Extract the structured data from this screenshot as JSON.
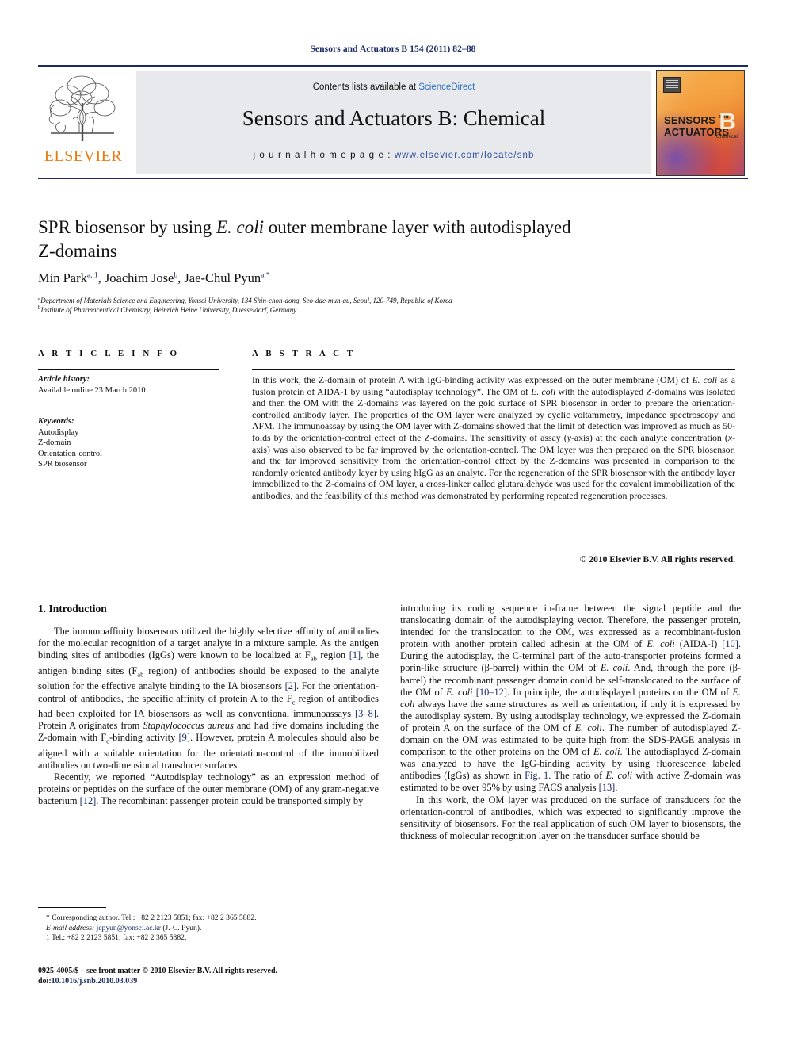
{
  "running_head": "Sensors and Actuators B 154 (2011) 82–88",
  "masthead": {
    "contents_prefix": "Contents lists available at ",
    "sciencedirect": "ScienceDirect",
    "journal_title": "Sensors and Actuators B: Chemical",
    "homepage_label": "j o u r n a l   h o m e p a g e :",
    "homepage_url": "www.elsevier.com/locate/snb",
    "publisher_wordmark": "ELSEVIER",
    "publisher_color": "#e87b10",
    "link_color": "#2c6fbb",
    "cover": {
      "line1": "SENSORS",
      "line1_small": "and",
      "line2": "ACTUATORS",
      "volume_letter": "B",
      "subtitle": "Chemical"
    }
  },
  "article": {
    "title_line1_a": "SPR biosensor by using ",
    "title_line1_italic": "E. coli",
    "title_line1_b": " outer membrane layer with autodisplayed",
    "title_line2": "Z-domains",
    "authors": [
      {
        "name": "Min Park",
        "sup": "a, 1"
      },
      {
        "name": "Joachim Jose",
        "sup": "b"
      },
      {
        "name": "Jae-Chul Pyun",
        "sup": "a,*"
      }
    ],
    "affiliations": [
      {
        "marker": "a",
        "text": "Department of Materials Science and Engineering, Yonsei University, 134 Shin-chon-dong, Seo-dae-mun-gu, Seoul, 120-749, Republic of Korea"
      },
      {
        "marker": "b",
        "text": "Institute of Pharmaceutical Chemistry, Heinrich Heine University, Duesseldorf, Germany"
      }
    ]
  },
  "info": {
    "heading": "A R T I C L E    I N F O",
    "history_label": "Article history:",
    "history_value": "Available online 23 March 2010",
    "keywords_label": "Keywords:",
    "keywords": [
      "Autodisplay",
      "Z-domain",
      "Orientation-control",
      "SPR biosensor"
    ]
  },
  "abstract": {
    "heading": "A B S T R A C T",
    "text_parts": [
      {
        "t": "In this work, the Z-domain of protein A with IgG-binding activity was expressed on the outer membrane (OM) of "
      },
      {
        "t": "E. coli",
        "i": true
      },
      {
        "t": " as a fusion protein of AIDA-1 by using “autodisplay technology”. The OM of "
      },
      {
        "t": "E. coli",
        "i": true
      },
      {
        "t": " with the autodisplayed Z-domains was isolated and then the OM with the Z-domains was layered on the gold surface of SPR biosensor in order to prepare the orientation-controlled antibody layer. The properties of the OM layer were analyzed by cyclic voltammetry, impedance spectroscopy and AFM. The immunoassay by using the OM layer with Z-domains showed that the limit of detection was improved as much as 50-folds by the orientation-control effect of the Z-domains. The sensitivity of assay ("
      },
      {
        "t": "y",
        "i": true
      },
      {
        "t": "-axis) at the each analyte concentration ("
      },
      {
        "t": "x",
        "i": true
      },
      {
        "t": "-axis) was also observed to be far improved by the orientation-control. The OM layer was then prepared on the SPR biosensor, and the far improved sensitivity from the orientation-control effect by the Z-domains was presented in comparison to the randomly oriented antibody layer by using hIgG as an analyte. For the regeneration of the SPR biosensor with the antibody layer immobilized to the Z-domains of OM layer, a cross-linker called glutaraldehyde was used for the covalent immobilization of the antibodies, and the feasibility of this method was demonstrated by performing repeated regeneration processes."
      }
    ],
    "copyright": "© 2010 Elsevier B.V. All rights reserved."
  },
  "body": {
    "section_number_title": "1.  Introduction",
    "left_paragraphs": [
      [
        {
          "t": "The immunoaffinity biosensors utilized the highly selective affinity of antibodies for the molecular recognition of a target analyte in a mixture sample. As the antigen binding sites of antibodies (IgGs) were known to be localized at F"
        },
        {
          "t": "ab",
          "sub": true
        },
        {
          "t": " region "
        },
        {
          "t": "[1]",
          "ref": true
        },
        {
          "t": ", the antigen binding sites (F"
        },
        {
          "t": "ab",
          "sub": true
        },
        {
          "t": " region) of antibodies should be exposed to the analyte solution for the effective analyte binding to the IA biosensors "
        },
        {
          "t": "[2]",
          "ref": true
        },
        {
          "t": ". For the orientation-control of antibodies, the specific affinity of protein A to the F"
        },
        {
          "t": "c",
          "sub": true
        },
        {
          "t": " region of antibodies had been exploited for IA biosensors as well as conventional immunoassays "
        },
        {
          "t": "[3–8]",
          "ref": true
        },
        {
          "t": ". Protein A originates from "
        },
        {
          "t": "Staphylococcus aureus",
          "i": true
        },
        {
          "t": " and had five domains including the Z-domain with F"
        },
        {
          "t": "c",
          "sub": true
        },
        {
          "t": "-binding activity "
        },
        {
          "t": "[9]",
          "ref": true
        },
        {
          "t": ". However, protein A molecules should also be aligned with a suitable orientation for the orientation-control of the immobilized antibodies on two-dimensional transducer surfaces."
        }
      ],
      [
        {
          "t": "Recently, we reported “Autodisplay technology” as an expression method of proteins or peptides on the surface of the outer membrane (OM) of any gram-negative bacterium "
        },
        {
          "t": "[12]",
          "ref": true
        },
        {
          "t": ". The recombinant passenger protein could be transported simply by"
        }
      ]
    ],
    "right_paragraphs": [
      [
        {
          "t": "introducing its coding sequence in-frame between the signal peptide and the translocating domain of the autodisplaying vector. Therefore, the passenger protein, intended for the translocation to the OM, was expressed as a recombinant-fusion protein with another protein called adhesin at the OM of "
        },
        {
          "t": "E. coli",
          "i": true
        },
        {
          "t": " (AIDA-I) "
        },
        {
          "t": "[10]",
          "ref": true
        },
        {
          "t": ". During the autodisplay, the C-terminal part of the auto-transporter proteins formed a porin-like structure (β-barrel) within the OM of "
        },
        {
          "t": "E. coli",
          "i": true
        },
        {
          "t": ". And, through the pore (β-barrel) the recombinant passenger domain could be self-translocated to the surface of the OM of "
        },
        {
          "t": "E. coli",
          "i": true
        },
        {
          "t": " "
        },
        {
          "t": "[10–12]",
          "ref": true
        },
        {
          "t": ". In principle, the autodisplayed proteins on the OM of "
        },
        {
          "t": "E. coli",
          "i": true
        },
        {
          "t": " always have the same structures as well as orientation, if only it is expressed by the autodisplay system. By using autodisplay technology, we expressed the Z-domain of protein A on the surface of the OM of "
        },
        {
          "t": "E. coli",
          "i": true
        },
        {
          "t": ". The number of autodisplayed Z-domain on the OM was estimated to be quite high from the SDS-PAGE analysis in comparison to the other proteins on the OM of "
        },
        {
          "t": "E. coli",
          "i": true
        },
        {
          "t": ". The autodisplayed Z-domain was analyzed to have the IgG-binding activity by using fluorescence labeled antibodies (IgGs) as shown in "
        },
        {
          "t": "Fig. 1",
          "ref": true
        },
        {
          "t": ". The ratio of "
        },
        {
          "t": "E. coli",
          "i": true
        },
        {
          "t": " with active Z-domain was estimated to be over 95% by using FACS analysis "
        },
        {
          "t": "[13]",
          "ref": true
        },
        {
          "t": "."
        }
      ],
      [
        {
          "t": "In this work, the OM layer was produced on the surface of transducers for the orientation-control of antibodies, which was expected to significantly improve the sensitivity of biosensors. For the real application of such OM layer to biosensors, the thickness of molecular recognition layer on the transducer surface should be"
        }
      ]
    ]
  },
  "footnotes": {
    "corresponding": "* Corresponding author. Tel.: +82 2 2123 5851; fax: +82 2 365 5882.",
    "email_label": "E-mail address:",
    "email": "jcpyun@yonsei.ac.kr",
    "email_suffix": "(J.-C. Pyun).",
    "footnote1": "1  Tel.: +82 2 2123 5851; fax: +82 2 365 5882."
  },
  "imprint": {
    "line1": "0925-4005/$ – see front matter © 2010 Elsevier B.V. All rights reserved.",
    "doi_label": "doi:",
    "doi_value": "10.1016/j.snb.2010.03.039"
  }
}
